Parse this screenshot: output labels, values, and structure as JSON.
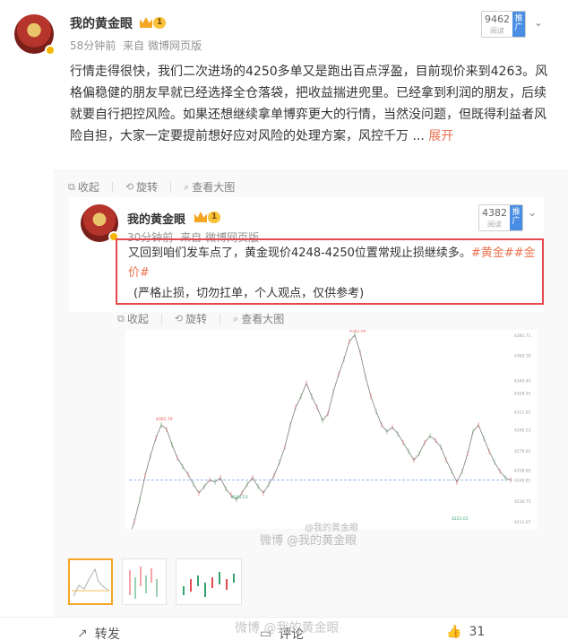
{
  "post": {
    "username": "我的黄金眼",
    "level": "1",
    "time": "58分钟前",
    "source_prefix": "来自",
    "source": "微博网页版",
    "reads": "9462",
    "reads_label": "阅读",
    "ad_label": "推广",
    "text": "行情走得很快，我们二次进场的4250多单又是跑出百点浮盈，目前现价来到4263。风格偏稳健的朋友早就已经选择全仓落袋，把收益揣进兜里。已经拿到利润的朋友，后续就要自行把控风险。如果还想继续拿单博弈更大的行情，当然没问题，但既得利益者风险自担，大家一定要提前想好应对风险的处理方案，风控千万",
    "ellipsis": "...",
    "expand_label": "展开"
  },
  "toolbar": {
    "collapse": "收起",
    "rotate": "旋转",
    "view_large": "查看大图"
  },
  "repost": {
    "username": "我的黄金眼",
    "level": "1",
    "time": "30分钟前",
    "source_prefix": "来自",
    "source": "微博网页版",
    "reads": "4382",
    "reads_label": "阅读",
    "ad_label": "推广",
    "text_main": "又回到咱们发车点了，黄金现价4248-4250位置常规止损继续多。",
    "tag1": "#黄金#",
    "tag2": "#金价#",
    "note": "(严格止损，切勿扛单，个人观点，仅供参考)"
  },
  "chart_data": {
    "type": "line",
    "title": "",
    "xlabel": "",
    "ylabel": "",
    "price_labels": [
      "4381.71",
      "4363.30",
      "4340.45",
      "4328.91",
      "4311.87",
      "4295.51",
      "4276.61",
      "4258.85",
      "4249.81",
      "4230.75",
      "4211.97"
    ],
    "annotations": [
      "4382.00",
      "4301.70",
      "4240.53",
      "4197.90",
      "4221.01"
    ],
    "current_line": 4249.81,
    "values": [
      4198,
      4212,
      4232,
      4254,
      4272,
      4288,
      4300,
      4296,
      4282,
      4270,
      4262,
      4255,
      4246,
      4238,
      4244,
      4250,
      4248,
      4252,
      4242,
      4236,
      4232,
      4238,
      4246,
      4252,
      4244,
      4238,
      4246,
      4254,
      4266,
      4280,
      4300,
      4316,
      4326,
      4338,
      4326,
      4316,
      4304,
      4310,
      4330,
      4346,
      4360,
      4376,
      4382,
      4366,
      4344,
      4326,
      4312,
      4300,
      4294,
      4298,
      4292,
      4284,
      4276,
      4268,
      4274,
      4284,
      4290,
      4286,
      4280,
      4268,
      4258,
      4248,
      4258,
      4274,
      4294,
      4300,
      4288,
      4276,
      4266,
      4258,
      4252,
      4250
    ]
  },
  "watermarks": {
    "chart": "微博 @我的黄金眼",
    "chart_small": "@我的黄金眼",
    "footer": "微博 @我的黄金眼"
  },
  "footer": {
    "forward": "转发",
    "comment": "评论",
    "like_count": "31"
  },
  "colors": {
    "accent": "#eb7350",
    "highlight_border": "#e5484d",
    "chart_line": "#8a8a8a",
    "current_line": "#6fa0e0"
  }
}
